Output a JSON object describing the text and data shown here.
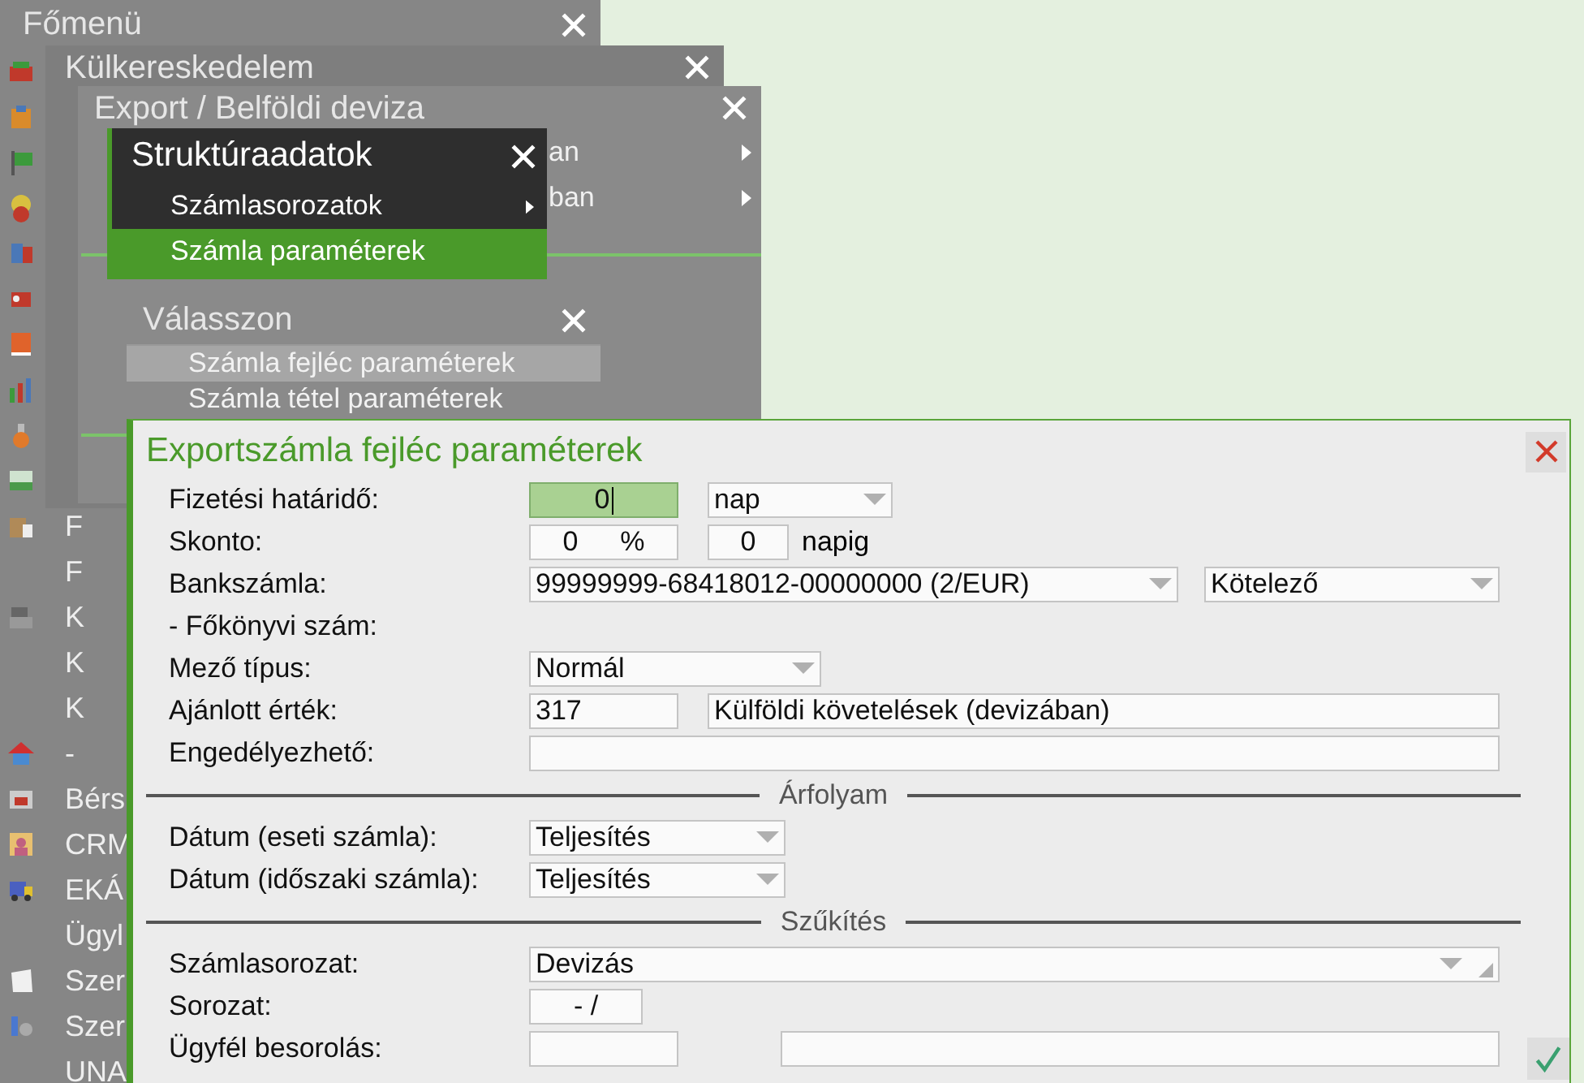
{
  "main_menu": {
    "title": "Főmenü",
    "items": [
      {
        "label": "F"
      },
      {
        "label": "F"
      },
      {
        "label": "K"
      },
      {
        "label": "K"
      },
      {
        "label": "K"
      },
      {
        "label": "-"
      },
      {
        "label": "Bérs"
      },
      {
        "label": "CRM"
      },
      {
        "label": "EKÁ"
      },
      {
        "label": "Ügyl"
      },
      {
        "label": "Szer"
      },
      {
        "label": "Szer"
      },
      {
        "label": "UNA"
      }
    ]
  },
  "trade_window": {
    "title": "Külkereskedelem"
  },
  "export_window": {
    "title": "Export / Belföldi deviza",
    "items": [
      {
        "label": "an",
        "submenu": true
      },
      {
        "label": "ban",
        "submenu": true
      }
    ]
  },
  "structure_menu": {
    "title": "Struktúraadatok",
    "items": [
      {
        "label": "Számlasorozatok",
        "submenu": true,
        "selected": false
      },
      {
        "label": "Számla paraméterek",
        "submenu": false,
        "selected": true
      }
    ]
  },
  "choose_window": {
    "title": "Válasszon",
    "items": [
      {
        "label": "Számla fejléc paraméterek",
        "selected": true
      },
      {
        "label": "Számla tétel paraméterek",
        "selected": false
      }
    ]
  },
  "form": {
    "title": "Exportszámla fejléc paraméterek",
    "rows": [
      {
        "kind": "field",
        "label": "Fizetési határidő:",
        "controls": [
          {
            "kind": "input",
            "value": "0",
            "focused": true
          },
          {
            "kind": "select",
            "value": "nap"
          }
        ]
      },
      {
        "kind": "field",
        "label": "Skonto:",
        "controls": [
          {
            "kind": "input",
            "value": "0",
            "unit": "%"
          },
          {
            "kind": "input",
            "value": "0"
          },
          {
            "kind": "text",
            "value": "napig"
          }
        ]
      },
      {
        "kind": "field",
        "label": "Bankszámla:",
        "controls": [
          {
            "kind": "select",
            "value": "99999999-68418012-00000000 (2/EUR)"
          },
          {
            "kind": "select",
            "value": "Kötelező"
          }
        ]
      },
      {
        "kind": "heading",
        "label": "- Főkönyvi szám:"
      },
      {
        "kind": "field",
        "label": "Mező típus:",
        "controls": [
          {
            "kind": "select",
            "value": "Normál"
          }
        ]
      },
      {
        "kind": "field",
        "label": "Ajánlott érték:",
        "controls": [
          {
            "kind": "input",
            "value": "317"
          },
          {
            "kind": "input",
            "value": "Külföldi követelések (devizában)"
          }
        ]
      },
      {
        "kind": "field",
        "label": "Engedélyezhető:",
        "controls": [
          {
            "kind": "input"
          }
        ]
      },
      {
        "kind": "section",
        "label": "Árfolyam"
      },
      {
        "kind": "field",
        "label": "Dátum (eseti számla):",
        "controls": [
          {
            "kind": "select",
            "value": "Teljesítés"
          }
        ]
      },
      {
        "kind": "field",
        "label": "Dátum (időszaki számla):",
        "controls": [
          {
            "kind": "select",
            "value": "Teljesítés"
          }
        ]
      },
      {
        "kind": "section",
        "label": "Szűkítés"
      },
      {
        "kind": "field",
        "label": "Számlasorozat:",
        "controls": [
          {
            "kind": "select",
            "value": "Devizás",
            "resizable": true
          }
        ]
      },
      {
        "kind": "field",
        "label": "Sorozat:",
        "controls": [
          {
            "kind": "input",
            "value": "-  /"
          }
        ]
      },
      {
        "kind": "field",
        "label": "Ügyfél besorolás:",
        "controls": [
          {
            "kind": "input"
          },
          {
            "kind": "input"
          }
        ]
      }
    ]
  }
}
